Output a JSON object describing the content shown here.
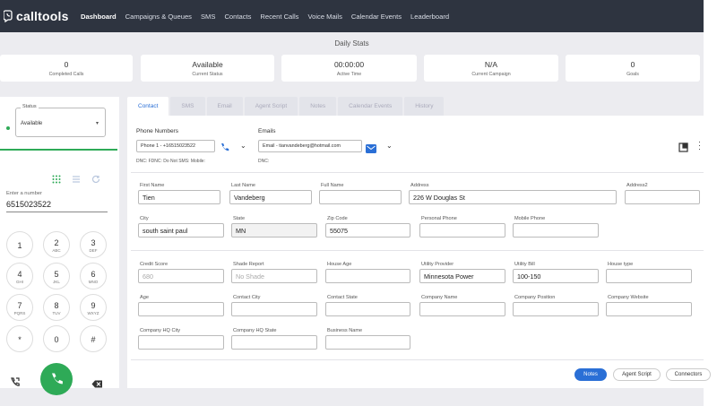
{
  "app": {
    "logo_text": "calltools"
  },
  "nav": {
    "items": [
      {
        "label": "Dashboard",
        "active": true
      },
      {
        "label": "Campaigns & Queues"
      },
      {
        "label": "SMS"
      },
      {
        "label": "Contacts"
      },
      {
        "label": "Recent Calls"
      },
      {
        "label": "Voice Mails"
      },
      {
        "label": "Calendar Events"
      },
      {
        "label": "Leaderboard"
      }
    ]
  },
  "daily_stats": {
    "title": "Daily Stats",
    "cards": [
      {
        "value": "0",
        "label": "Completed Calls"
      },
      {
        "value": "Available",
        "label": "Current Status"
      },
      {
        "value": "00:00:00",
        "label": "Active Time"
      },
      {
        "value": "N/A",
        "label": "Current Campaign"
      },
      {
        "value": "0",
        "label": "Goals"
      }
    ]
  },
  "dialer": {
    "status_label": "Status",
    "status_value": "Available",
    "number_label": "Enter a number",
    "number_value": "6515023522",
    "keys": [
      {
        "digit": "1",
        "letters": ""
      },
      {
        "digit": "2",
        "letters": "ABC"
      },
      {
        "digit": "3",
        "letters": "DEF"
      },
      {
        "digit": "4",
        "letters": "GHI"
      },
      {
        "digit": "5",
        "letters": "JKL"
      },
      {
        "digit": "6",
        "letters": "MNO"
      },
      {
        "digit": "7",
        "letters": "PQRS"
      },
      {
        "digit": "8",
        "letters": "TUV"
      },
      {
        "digit": "9",
        "letters": "WXYZ"
      },
      {
        "digit": "*",
        "letters": ""
      },
      {
        "digit": "0",
        "letters": ""
      },
      {
        "digit": "#",
        "letters": ""
      }
    ]
  },
  "tabs": [
    {
      "label": "Contact",
      "active": true
    },
    {
      "label": "SMS"
    },
    {
      "label": "Email"
    },
    {
      "label": "Agent Script"
    },
    {
      "label": "Notes"
    },
    {
      "label": "Calendar Events"
    },
    {
      "label": "History"
    }
  ],
  "contact": {
    "phone_numbers_label": "Phone Numbers",
    "phone_select": "Phone 1 - +16515023522",
    "phone_flags": "DNC:  FDNC:  Do Not SMS:  Mobile:",
    "emails_label": "Emails",
    "email_select": "Email - tianvandeberg@hotmail.com",
    "email_flags": "DNC:",
    "fields": {
      "first_name": {
        "label": "First Name",
        "value": "Tien"
      },
      "last_name": {
        "label": "Last Name",
        "value": "Vandeberg"
      },
      "full_name": {
        "label": "Full Name",
        "value": ""
      },
      "address": {
        "label": "Address",
        "value": "226 W Douglas St"
      },
      "address2": {
        "label": "Address2",
        "value": ""
      },
      "city": {
        "label": "City",
        "value": "south saint paul"
      },
      "state": {
        "label": "State",
        "value": "MN"
      },
      "zip": {
        "label": "Zip Code",
        "value": "55075"
      },
      "personal_phone": {
        "label": "Personal Phone",
        "value": ""
      },
      "mobile_phone": {
        "label": "Mobile Phone",
        "value": ""
      },
      "credit_score": {
        "label": "Credit Score",
        "placeholder": "680"
      },
      "shade_report": {
        "label": "Shade Report",
        "placeholder": "No Shade"
      },
      "house_age": {
        "label": "House Age",
        "value": ""
      },
      "utility_provider": {
        "label": "Utility Provider",
        "value": "Minnesota Power"
      },
      "utility_bill": {
        "label": "Utility Bill",
        "value": "100-150"
      },
      "house_type": {
        "label": "House type",
        "value": ""
      },
      "age": {
        "label": "Age",
        "value": ""
      },
      "contact_city": {
        "label": "Contact City",
        "value": ""
      },
      "contact_state": {
        "label": "Contact State",
        "value": ""
      },
      "company_name": {
        "label": "Company Name",
        "value": ""
      },
      "company_position": {
        "label": "Company Position",
        "value": ""
      },
      "company_website": {
        "label": "Company Website",
        "value": ""
      },
      "company_hq_city": {
        "label": "Company HQ City",
        "value": ""
      },
      "company_hq_state": {
        "label": "Company HQ State",
        "value": ""
      },
      "business_name": {
        "label": "Business Name",
        "value": ""
      }
    }
  },
  "bottom_buttons": {
    "notes": "Notes",
    "agent_script": "Agent Script",
    "connectors": "Connectors"
  },
  "colors": {
    "accent": "#2a6fd6",
    "nav_bg": "#2e3440",
    "call_green": "#2eaa57"
  }
}
